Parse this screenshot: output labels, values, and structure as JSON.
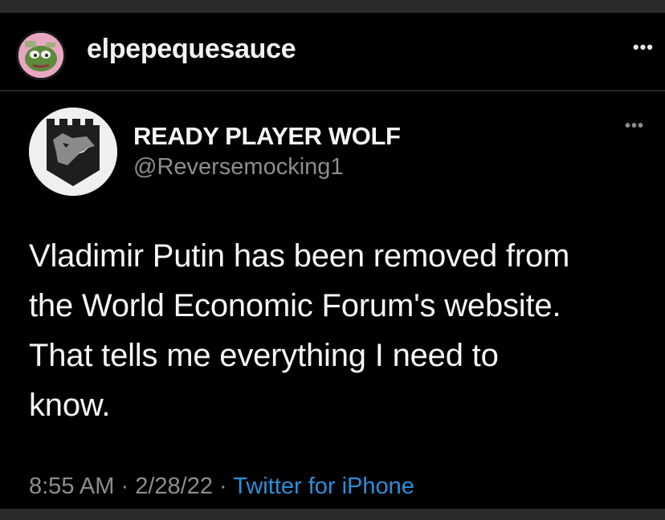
{
  "post": {
    "username": "elpepequesauce",
    "more_icon": "more-dots-icon",
    "avatar": "pepe-avatar"
  },
  "tweet": {
    "display_name": "READY PLAYER WOLF",
    "handle": "@Reversemocking1",
    "avatar": "wolf-shield-avatar",
    "more_icon": "more-dots-icon",
    "text_lines": [
      "Vladimir Putin has been removed from",
      "the World Economic Forum's website.",
      "That tells me everything I need to",
      "know."
    ],
    "time": "8:55 AM",
    "date": "2/28/22",
    "separator": "·",
    "source": "Twitter for iPhone"
  },
  "colors": {
    "background": "#000000",
    "primary_text": "#f4f4f4",
    "secondary_text": "#8d8d8d",
    "link": "#2b8fd8"
  }
}
